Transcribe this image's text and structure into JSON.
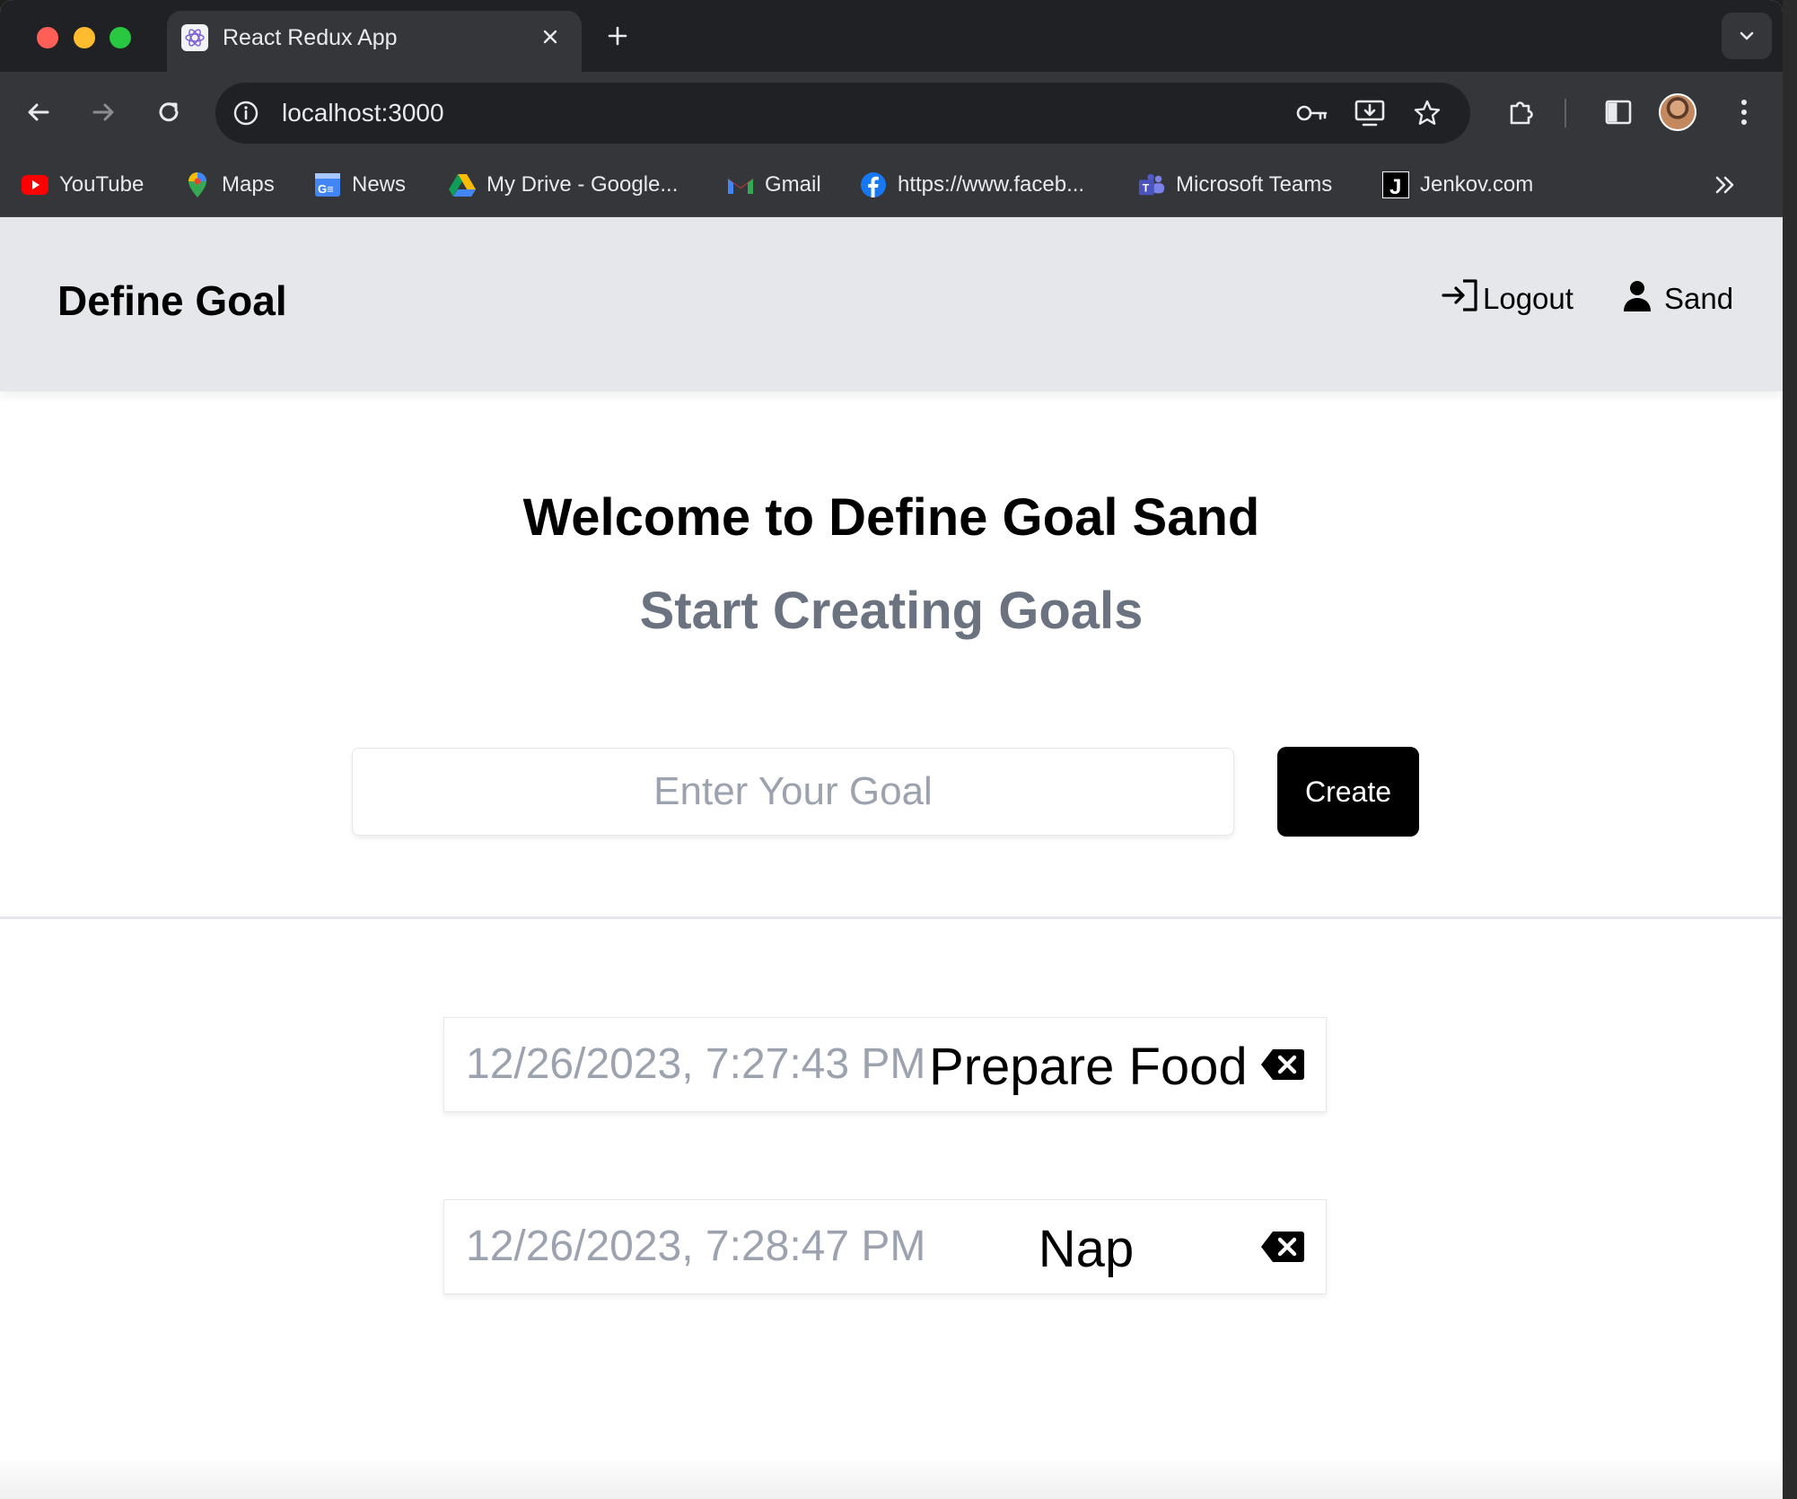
{
  "browser": {
    "tab_title": "React Redux App",
    "url": "localhost:3000",
    "bookmarks": [
      {
        "label": "YouTube",
        "icon": "youtube-icon"
      },
      {
        "label": "Maps",
        "icon": "maps-icon"
      },
      {
        "label": "News",
        "icon": "news-icon"
      },
      {
        "label": "My Drive - Google...",
        "icon": "drive-icon"
      },
      {
        "label": "Gmail",
        "icon": "gmail-icon"
      },
      {
        "label": "https://www.faceb...",
        "icon": "facebook-icon"
      },
      {
        "label": "Microsoft Teams",
        "icon": "teams-icon"
      },
      {
        "label": "Jenkov.com",
        "icon": "jenkov-icon"
      }
    ]
  },
  "app": {
    "brand": "Define Goal",
    "nav": {
      "logout_label": "Logout",
      "user_label": "Sand"
    },
    "welcome_title": "Welcome to Define Goal Sand",
    "subtitle": "Start Creating Goals",
    "form": {
      "placeholder": "Enter Your Goal",
      "value": "",
      "create_label": "Create"
    },
    "goals": [
      {
        "date": "12/26/2023, 7:27:43 PM",
        "text": "Prepare Food"
      },
      {
        "date": "12/26/2023, 7:28:47 PM",
        "text": "Nap"
      }
    ]
  },
  "colors": {
    "header_bg": "#e5e7eb",
    "subtitle": "#6b7280",
    "date_text": "#9ca3af",
    "button_bg": "#000000"
  }
}
